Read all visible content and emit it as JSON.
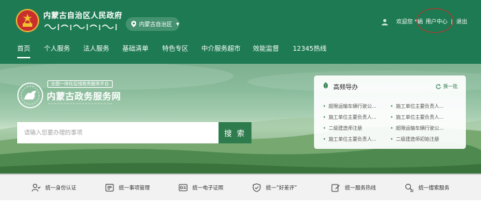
{
  "header": {
    "gov_title": "内蒙古自治区人民政府",
    "region": "内蒙古自治区",
    "welcome": "欢迎您 *娟",
    "user_center": "用户中心",
    "separator": "|",
    "logout": "退出"
  },
  "nav": {
    "items": [
      "首页",
      "个人服务",
      "法人服务",
      "基础清单",
      "特色专区",
      "中介服务超市",
      "效能监督",
      "12345热线"
    ]
  },
  "brand": {
    "tag": "全国一体化在线政务服务平台",
    "name": "内蒙古政务服务网"
  },
  "search": {
    "placeholder": "请输入您要办理的事项",
    "button": "搜 索"
  },
  "guide": {
    "title": "高频导办",
    "refresh": "换一批",
    "items": [
      "超限运输车辆行驶公...",
      "施工单位主要负责人...",
      "施工单位主要负责人...",
      "施工单位主要负责人...",
      "二级建造师注册",
      "超限运输车辆行驶公...",
      "施工单位主要负责人...",
      "二级建造师初始注册"
    ]
  },
  "services": [
    "统一身份认证",
    "统一事项管理",
    "统一电子证照",
    "统一“好差评”",
    "统一服务热线",
    "统一搜索服务"
  ],
  "colors": {
    "header_green": "#1d7a52",
    "accent_green": "#2e7c4d",
    "highlight_ring": "#c9302c"
  }
}
